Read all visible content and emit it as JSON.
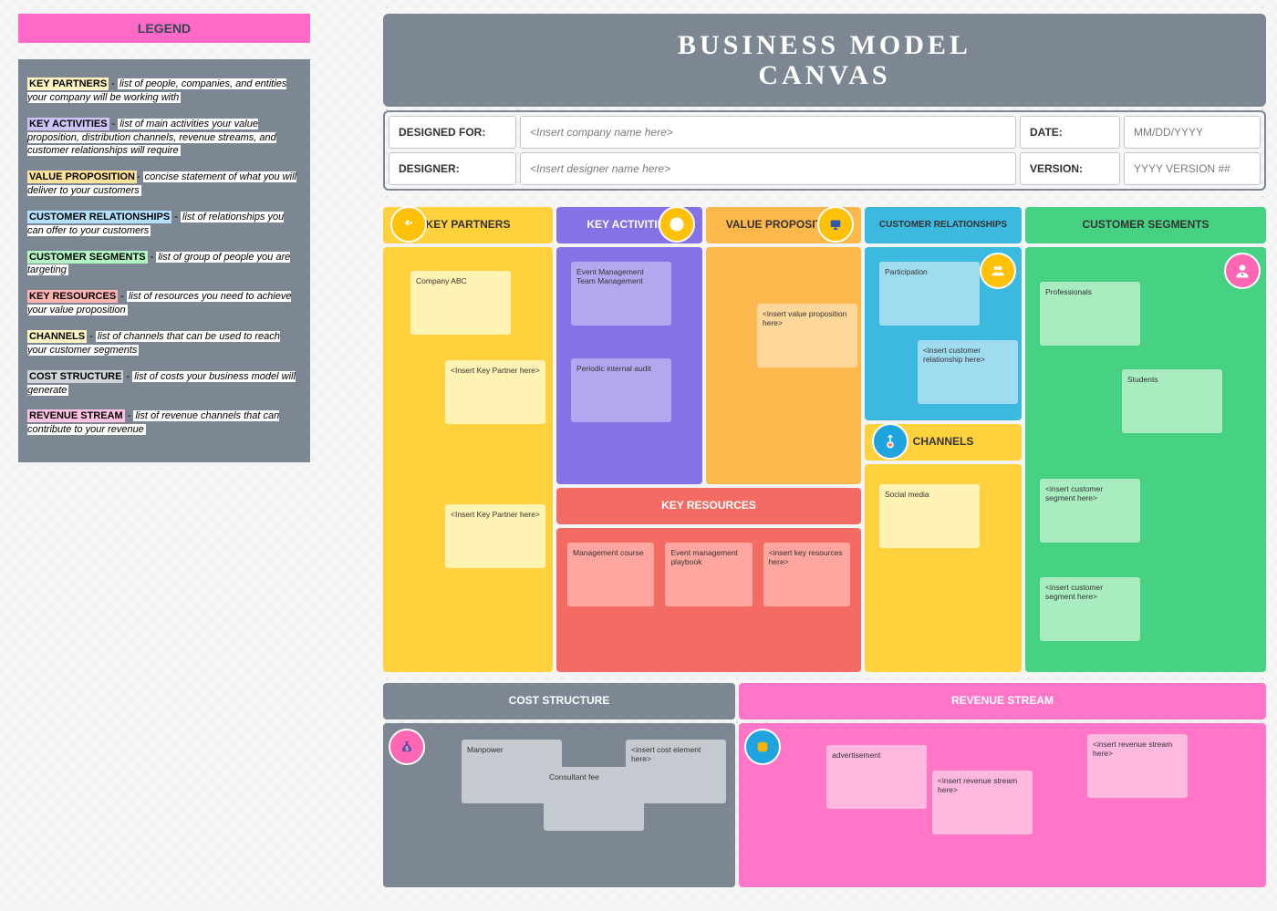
{
  "legend": {
    "title": "LEGEND",
    "items": [
      {
        "key": "KEY PARTNERS",
        "desc": "list of people, companies, and entities your company will be working with",
        "cls": "k-kp"
      },
      {
        "key": "KEY ACTIVITIES",
        "desc": "list of main activities your value proposition, distribution channels, revenue streams, and customer relationships will require",
        "cls": "k-ka"
      },
      {
        "key": "VALUE PROPOSITION",
        "desc": "concise statement of what you will deliver to your customers",
        "cls": "k-vp"
      },
      {
        "key": "CUSTOMER RELATIONSHIPS",
        "desc": "list of relationships you can offer to your customers",
        "cls": "k-cr"
      },
      {
        "key": "CUSTOMER SEGMENTS",
        "desc": "list of group of people you are targeting",
        "cls": "k-cs"
      },
      {
        "key": "KEY RESOURCES",
        "desc": "list of resources you need to achieve your value proposition",
        "cls": "k-kr"
      },
      {
        "key": "CHANNELS",
        "desc": "list of channels that can be used to reach your customer segments",
        "cls": "k-ch"
      },
      {
        "key": "COST STRUCTURE",
        "desc": "list of costs your business model will generate",
        "cls": "k-co"
      },
      {
        "key": "REVENUE STREAM",
        "desc": "list of revenue channels that can contribute to your revenue",
        "cls": "k-rs"
      }
    ]
  },
  "header": {
    "title_l1": "BUSINESS MODEL",
    "title_l2": "CANVAS"
  },
  "meta": {
    "designed_for_label": "DESIGNED FOR:",
    "designed_for_value": "<Insert company name here>",
    "date_label": "DATE:",
    "date_value": "MM/DD/YYYY",
    "designer_label": "DESIGNER:",
    "designer_value": "<Insert designer name here>",
    "version_label": "VERSION:",
    "version_value": "YYYY VERSION ##"
  },
  "sections": {
    "key_partners": {
      "title": "KEY PARTNERS",
      "notes": [
        "Company ABC",
        "<Insert Key Partner here>",
        "<Insert Key Partner here>"
      ]
    },
    "key_activities": {
      "title": "KEY ACTIVITIES",
      "notes": [
        "Event Management\nTeam Management",
        "Periodic internal audit"
      ]
    },
    "value_proposition": {
      "title": "VALUE PROPOSITION",
      "notes": [
        "<insert value proposition here>"
      ]
    },
    "customer_relationships": {
      "title": "CUSTOMER RELATIONSHIPS",
      "notes": [
        "Participation",
        "<insert customer relationship here>"
      ]
    },
    "customer_segments": {
      "title": "CUSTOMER SEGMENTS",
      "notes": [
        "Professionals",
        "Students",
        "<insert customer segment here>",
        "<insert customer segment here>"
      ]
    },
    "key_resources": {
      "title": "KEY RESOURCES",
      "notes": [
        "Management course",
        "Event management playbook",
        "<insert key resources here>"
      ]
    },
    "channels": {
      "title": "CHANNELS",
      "notes": [
        "Social media"
      ]
    },
    "cost_structure": {
      "title": "COST STRUCTURE",
      "notes": [
        "Manpower",
        "Consultant fee",
        "<insert cost element here>"
      ]
    },
    "revenue_stream": {
      "title": "REVENUE STREAM",
      "notes": [
        "advertisement",
        "<insert revenue stream here>",
        "<insert revenue stream here>"
      ]
    }
  }
}
